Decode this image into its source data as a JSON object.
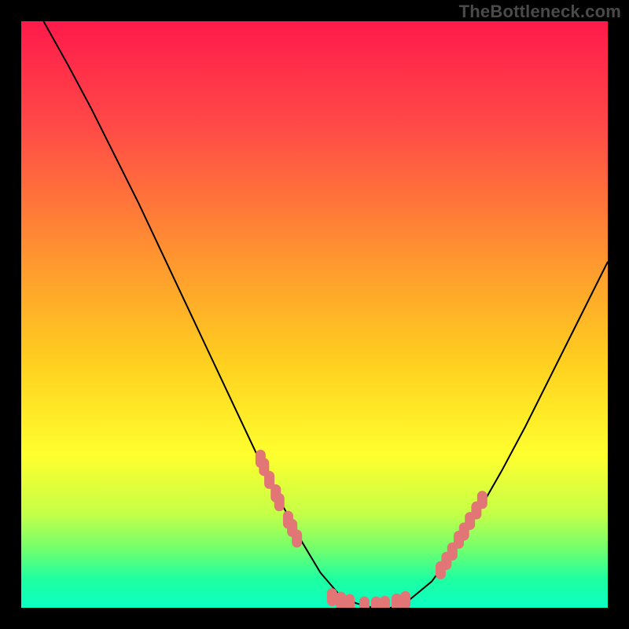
{
  "watermark": "TheBottleneck.com",
  "chart_data": {
    "type": "line",
    "title": "",
    "xlabel": "",
    "ylabel": "",
    "xlim": [
      0,
      100
    ],
    "ylim": [
      0,
      100
    ],
    "grid": false,
    "legend": false,
    "gradient_stops": [
      {
        "offset": 0,
        "color": "#ff1a4b"
      },
      {
        "offset": 18,
        "color": "#ff4a47"
      },
      {
        "offset": 40,
        "color": "#ff9430"
      },
      {
        "offset": 58,
        "color": "#ffcf1f"
      },
      {
        "offset": 74,
        "color": "#ffff2e"
      },
      {
        "offset": 84,
        "color": "#c4ff47"
      },
      {
        "offset": 90,
        "color": "#71ff6e"
      },
      {
        "offset": 95,
        "color": "#1fffa0"
      },
      {
        "offset": 100,
        "color": "#0bffc3"
      }
    ],
    "series": [
      {
        "name": "curve",
        "stroke": "#000000",
        "x": [
          3.8,
          8,
          12,
          16,
          20,
          24,
          28,
          32,
          36,
          40,
          44,
          48,
          51,
          54,
          57,
          60,
          63,
          66,
          70,
          74,
          78,
          82,
          86,
          90,
          94,
          98,
          100
        ],
        "y": [
          100,
          92.5,
          85,
          77,
          69,
          60.5,
          52,
          43.5,
          35,
          26.5,
          18.5,
          11,
          6,
          2.5,
          0.8,
          0,
          0,
          1.2,
          4.5,
          10,
          16.5,
          23.5,
          31,
          39,
          47,
          55,
          59
        ]
      }
    ],
    "markers": {
      "color": "#e27575",
      "groups": [
        {
          "name": "left-cluster",
          "points": [
            {
              "x": 40.8,
              "y": 25.4
            },
            {
              "x": 41.4,
              "y": 24.0
            },
            {
              "x": 42.3,
              "y": 21.8
            },
            {
              "x": 43.4,
              "y": 19.5
            },
            {
              "x": 44.0,
              "y": 18.0
            },
            {
              "x": 45.5,
              "y": 15.0
            },
            {
              "x": 46.2,
              "y": 13.6
            },
            {
              "x": 47.0,
              "y": 11.8
            }
          ]
        },
        {
          "name": "bottom-cluster",
          "points": [
            {
              "x": 53.0,
              "y": 1.8
            },
            {
              "x": 54.5,
              "y": 1.2
            },
            {
              "x": 56.0,
              "y": 0.8
            },
            {
              "x": 58.5,
              "y": 0.4
            },
            {
              "x": 60.5,
              "y": 0.4
            },
            {
              "x": 62.0,
              "y": 0.5
            },
            {
              "x": 64.0,
              "y": 0.9
            },
            {
              "x": 65.5,
              "y": 1.3
            }
          ]
        },
        {
          "name": "right-cluster",
          "points": [
            {
              "x": 71.5,
              "y": 6.4
            },
            {
              "x": 72.5,
              "y": 8.0
            },
            {
              "x": 73.5,
              "y": 9.6
            },
            {
              "x": 74.6,
              "y": 11.6
            },
            {
              "x": 75.5,
              "y": 13.0
            },
            {
              "x": 76.5,
              "y": 14.8
            },
            {
              "x": 77.6,
              "y": 16.6
            },
            {
              "x": 78.6,
              "y": 18.4
            }
          ]
        }
      ]
    }
  }
}
